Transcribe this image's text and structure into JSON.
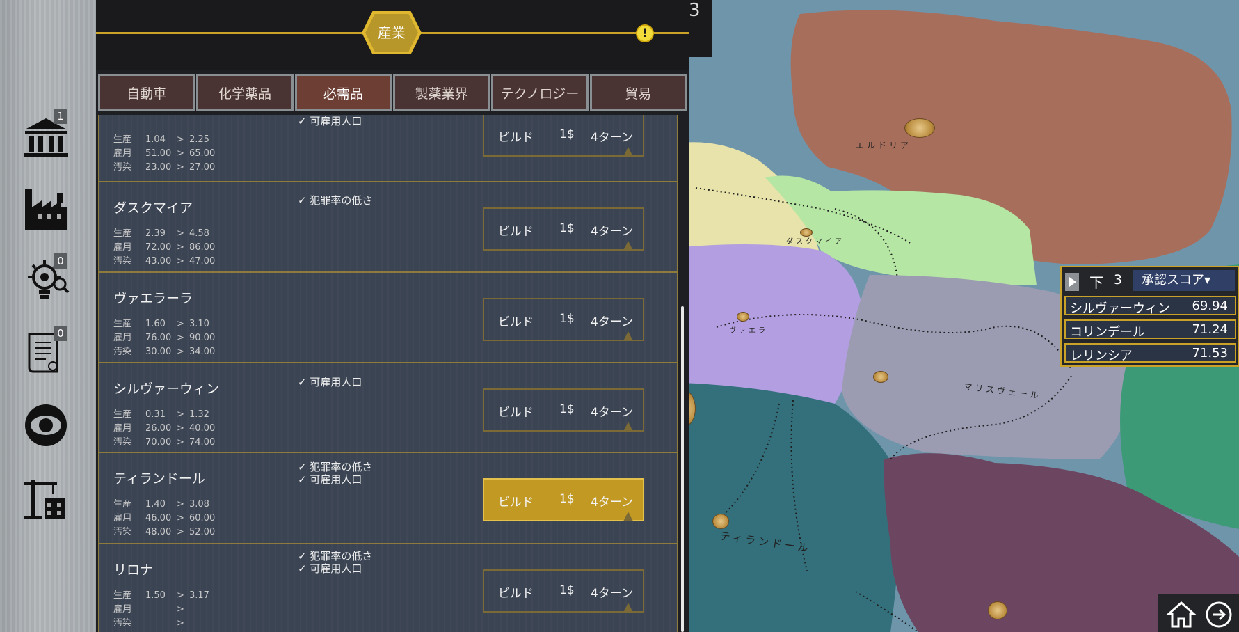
{
  "header": {
    "category": "産業",
    "alert_symbol": "!",
    "overflow_digit": "3"
  },
  "tabs": [
    {
      "label": "自動車",
      "active": false
    },
    {
      "label": "化学薬品",
      "active": false
    },
    {
      "label": "必需品",
      "active": true
    },
    {
      "label": "製薬業界",
      "active": false
    },
    {
      "label": "テクノロジー",
      "active": false
    },
    {
      "label": "貿易",
      "active": false
    }
  ],
  "rail": {
    "government": {
      "icon": "government-building-icon",
      "badge": "1"
    },
    "industry": {
      "icon": "factory-icon"
    },
    "research": {
      "icon": "research-bulb-gear-icon",
      "badge": "0"
    },
    "policies": {
      "icon": "document-scroll-icon",
      "badge": "0"
    },
    "intelligence": {
      "icon": "eye-icon"
    },
    "construction": {
      "icon": "construction-crane-icon"
    }
  },
  "stat_labels": {
    "production": "生産",
    "employment": "雇用",
    "pollution": "汚染",
    "arrow": ">"
  },
  "build_labels": {
    "action": "ビルド",
    "cost": "1$",
    "duration": "4ターン"
  },
  "cities": [
    {
      "name": "",
      "production": [
        "1.04",
        "2.25"
      ],
      "employment": [
        "51.00",
        "65.00"
      ],
      "pollution": [
        "23.00",
        "27.00"
      ],
      "requirements": [
        "✓ 可雇用人口"
      ]
    },
    {
      "name": "ダスクマイア",
      "production": [
        "2.39",
        "4.58"
      ],
      "employment": [
        "72.00",
        "86.00"
      ],
      "pollution": [
        "43.00",
        "47.00"
      ],
      "requirements": [
        "✓ 犯罪率の低さ"
      ]
    },
    {
      "name": "ヴァエラーラ",
      "production": [
        "1.60",
        "3.10"
      ],
      "employment": [
        "76.00",
        "90.00"
      ],
      "pollution": [
        "30.00",
        "34.00"
      ],
      "requirements": []
    },
    {
      "name": "シルヴァーウィン",
      "production": [
        "0.31",
        "1.32"
      ],
      "employment": [
        "26.00",
        "40.00"
      ],
      "pollution": [
        "70.00",
        "74.00"
      ],
      "requirements": [
        "✓ 可雇用人口"
      ]
    },
    {
      "name": "ティランドール",
      "production": [
        "1.40",
        "3.08"
      ],
      "employment": [
        "46.00",
        "60.00"
      ],
      "pollution": [
        "48.00",
        "52.00"
      ],
      "requirements": [
        "✓ 犯罪率の低さ",
        "✓ 可雇用人口"
      ]
    },
    {
      "name": "リロナ",
      "production": [
        "1.50",
        "3.17"
      ],
      "employment": [
        "",
        ""
      ],
      "pollution": [
        "",
        ""
      ],
      "requirements": [
        "✓ 犯罪率の低さ",
        "✓ 可雇用人口"
      ]
    }
  ],
  "score_panel": {
    "direction": "下",
    "count": "3",
    "metric": "承認スコア▾",
    "rows": [
      {
        "name": "シルヴァーウィン",
        "value": "69.94"
      },
      {
        "name": "コリンデール",
        "value": "71.24"
      },
      {
        "name": "レリンシア",
        "value": "71.53"
      }
    ]
  },
  "map_labels": {
    "north": "エルドリア",
    "dusk": "ダスクマイア",
    "valera": "ヴァエラ",
    "marisvale": "マリスヴェール",
    "tirandor": "ティランドール"
  },
  "colors": {
    "accent_gold": "#c9a227",
    "card_bg": "#3b4453",
    "tab_bg": "#4a3433",
    "tab_active": "#6d3e34",
    "build_highlight": "#c29a23"
  },
  "bottom_nav": {
    "home": "home-icon",
    "next": "next-arrow-icon"
  }
}
